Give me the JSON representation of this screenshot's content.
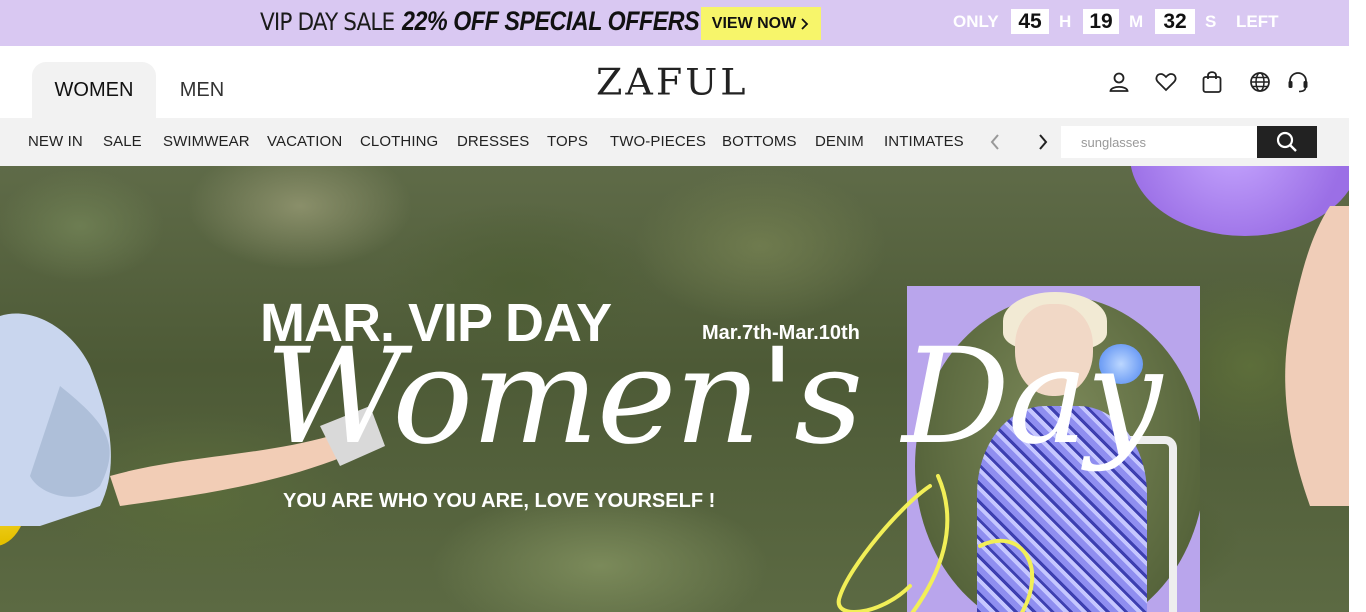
{
  "promo": {
    "title": "VIP DAY SALE",
    "offer": "22% OFF SPECIAL OFFERS",
    "cta": "VIEW NOW",
    "cta_icon": "chevron-right-icon",
    "countdown": {
      "prefix": "ONLY",
      "hours": "45",
      "hours_unit": "H",
      "minutes": "19",
      "minutes_unit": "M",
      "seconds": "32",
      "seconds_unit": "S",
      "suffix": "LEFT"
    }
  },
  "header": {
    "tabs": [
      {
        "label": "WOMEN",
        "active": true
      },
      {
        "label": "MEN",
        "active": false
      }
    ],
    "logo": "ZAFUL",
    "icons": [
      "user-icon",
      "heart-icon",
      "bag-icon",
      "globe-icon",
      "headset-icon"
    ]
  },
  "nav": {
    "items": [
      "NEW IN",
      "SALE",
      "SWIMWEAR",
      "VACATION",
      "CLOTHING",
      "DRESSES",
      "TOPS",
      "TWO-PIECES",
      "BOTTOMS",
      "DENIM",
      "INTIMATES"
    ],
    "search": {
      "placeholder": "sunglasses",
      "value": ""
    }
  },
  "hero": {
    "headline": "MAR. VIP DAY",
    "dates": "Mar.7th-Mar.10th",
    "script": "Women's Day",
    "tagline": "YOU ARE WHO YOU ARE, LOVE YOURSELF !",
    "accent_purple": "#b9a5ec",
    "accent_yellow": "#f2ef57"
  },
  "colors": {
    "promo_bg": "#d9c8f2",
    "cta_bg": "#f7f56a",
    "nav_bg": "#f2f2f2",
    "search_button": "#222222"
  }
}
